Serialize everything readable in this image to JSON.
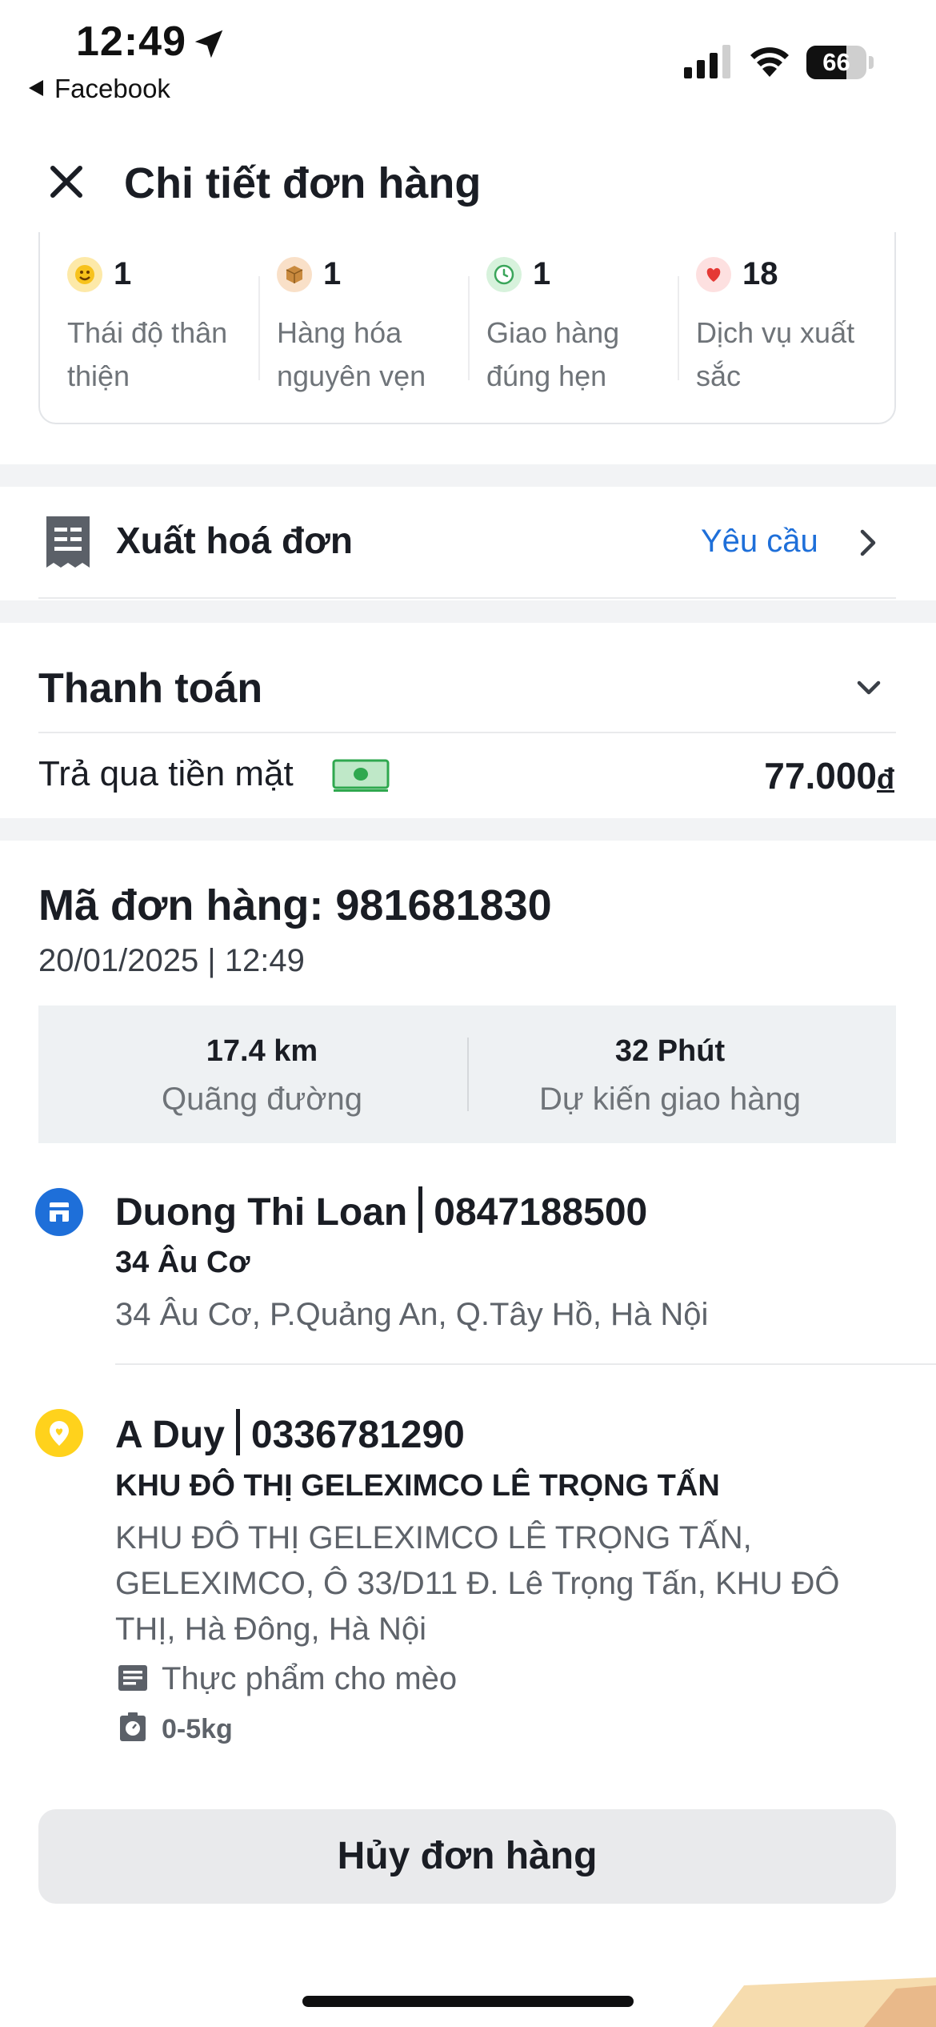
{
  "status_bar": {
    "time": "12:49",
    "back_app": "Facebook",
    "battery": "66",
    "battery_level": 0.66
  },
  "header": {
    "title": "Chi tiết đơn hàng"
  },
  "ratings": [
    {
      "count": "1",
      "label": "Thái độ thân thiện",
      "icon": "smile-face-icon"
    },
    {
      "count": "1",
      "label": "Hàng hóa nguyên vẹn",
      "icon": "package-icon"
    },
    {
      "count": "1",
      "label": "Giao hàng đúng hẹn",
      "icon": "clock-icon"
    },
    {
      "count": "18",
      "label": "Dịch vụ xuất sắc",
      "icon": "heart-icon"
    }
  ],
  "invoice": {
    "label": "Xuất hoá đơn",
    "action": "Yêu cầu"
  },
  "payment": {
    "title": "Thanh toán",
    "method": "Trả qua tiền mặt",
    "amount": "77.000",
    "currency": "đ"
  },
  "order": {
    "code_label": "Mã đơn hàng: 981681830",
    "datetime": "20/01/2025 | 12:49",
    "distance_value": "17.4 km",
    "distance_label": "Quãng đường",
    "eta_value": "32 Phút",
    "eta_label": "Dự kiến giao hàng"
  },
  "pickup": {
    "name": "Duong Thi Loan",
    "phone": "0847188500",
    "title": "34 Âu Cơ",
    "address": "34 Âu Cơ, P.Quảng An, Q.Tây Hồ, Hà Nội"
  },
  "dropoff": {
    "name": "A Duy",
    "phone": "0336781290",
    "title": "KHU ĐÔ THỊ GELEXIMCO LÊ TRỌNG TẤN",
    "address": "KHU ĐÔ THỊ GELEXIMCO LÊ TRỌNG TẤN, GELEXIMCO, Ô 33/D11 Đ. Lê Trọng Tấn, KHU ĐÔ THỊ, Hà Đông, Hà Nội",
    "note": "Thực phẩm  cho  mèo",
    "weight": "0-5kg"
  },
  "actions": {
    "cancel": "Hủy đơn hàng"
  },
  "colors": {
    "accent_blue": "#1e6fd9",
    "pickup_blue": "#1e6fd9",
    "dropoff_yellow": "#ffd21c",
    "cash_green": "#2fa84f"
  }
}
